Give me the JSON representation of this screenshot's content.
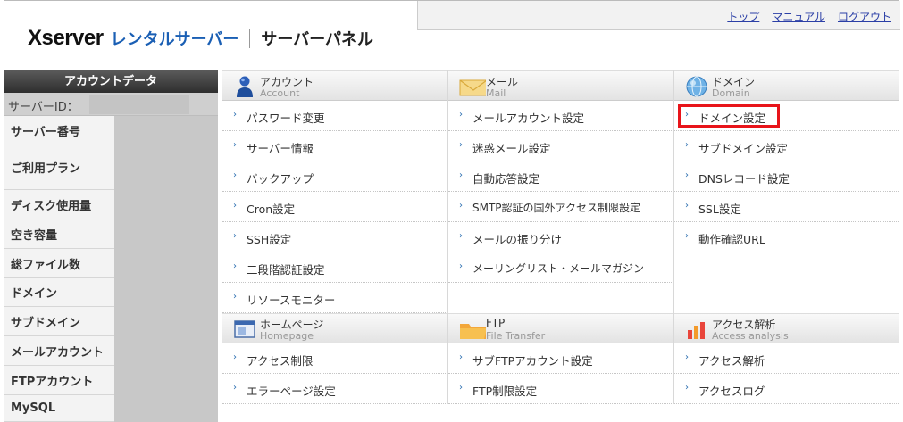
{
  "header": {
    "brand": "Xserver",
    "brand_sub": "レンタルサーバー",
    "panel": "サーバーパネル",
    "nav": [
      "トップ",
      "マニュアル",
      "ログアウト"
    ]
  },
  "sidebar": {
    "title": "アカウントデータ",
    "server_id_label": "サーバーID：",
    "rows": [
      "サーバー番号",
      "ご利用プラン",
      "ディスク使用量",
      "空き容量",
      "総ファイル数",
      "ドメイン",
      "サブドメイン",
      "メールアカウント",
      "FTPアカウント",
      "MySQL"
    ]
  },
  "sections": {
    "account": {
      "title": "アカウント",
      "subtitle": "Account",
      "items": [
        "パスワード変更",
        "サーバー情報",
        "バックアップ",
        "Cron設定",
        "SSH設定",
        "二段階認証設定",
        "リソースモニター"
      ]
    },
    "mail": {
      "title": "メール",
      "subtitle": "Mail",
      "items": [
        "メールアカウント設定",
        "迷惑メール設定",
        "自動応答設定",
        "SMTP認証の国外アクセス制限設定",
        "メールの振り分け",
        "メーリングリスト・メールマガジン"
      ]
    },
    "domain": {
      "title": "ドメイン",
      "subtitle": "Domain",
      "items": [
        "ドメイン設定",
        "サブドメイン設定",
        "DNSレコード設定",
        "SSL設定",
        "動作確認URL"
      ]
    },
    "homepage": {
      "title": "ホームページ",
      "subtitle": "Homepage",
      "items": [
        "アクセス制限",
        "エラーページ設定"
      ]
    },
    "ftp": {
      "title": "FTP",
      "subtitle": "File Transfer",
      "items": [
        "サブFTPアカウント設定",
        "FTP制限設定"
      ]
    },
    "access": {
      "title": "アクセス解析",
      "subtitle": "Access analysis",
      "items": [
        "アクセス解析",
        "アクセスログ"
      ]
    }
  },
  "highlight_color": "#e8141a",
  "arrow_glyph": "›"
}
